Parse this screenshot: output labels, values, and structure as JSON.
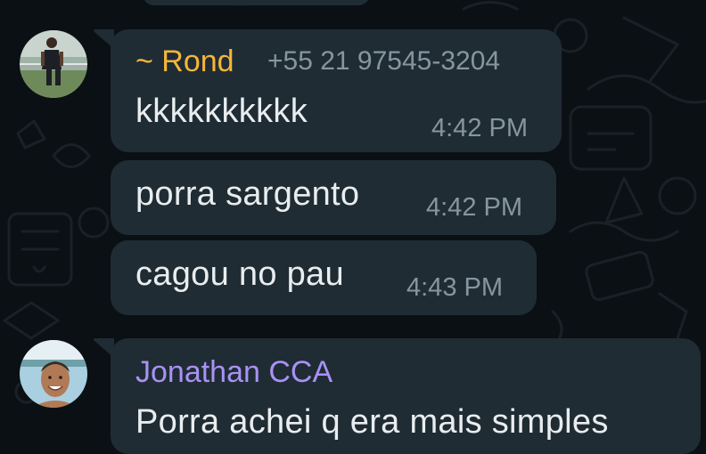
{
  "theme": {
    "bubble_color": "#1f2c34",
    "background_color": "#0b1014",
    "message_text_color": "#e9edef",
    "meta_text_color": "#8696a0"
  },
  "messages": [
    {
      "sender": "~ Rond",
      "sender_color": "#f5b53a",
      "phone": "+55 21 97545-3204",
      "avatar_icon": "avatar-photo-soccer-player",
      "text": "kkkkkkkkkk",
      "time": "4:42 PM"
    },
    {
      "text": "porra sargento",
      "time": "4:42 PM"
    },
    {
      "text": "cagou no pau",
      "time": "4:43 PM"
    },
    {
      "sender": "Jonathan CCA",
      "sender_color": "#a991f5",
      "avatar_icon": "avatar-photo-smiling-man",
      "text": "Porra achei q era mais simples"
    }
  ]
}
